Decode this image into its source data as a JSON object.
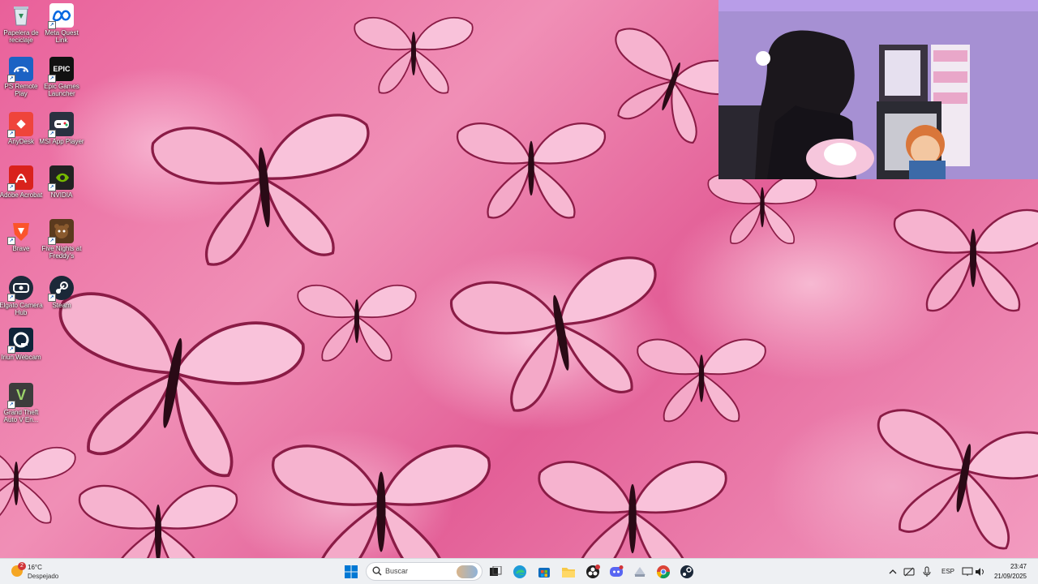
{
  "desktop": {
    "icons": [
      {
        "label": "Papelera de reciclaje",
        "icon": "recycle-bin-icon"
      },
      {
        "label": "Meta Quest Link",
        "icon": "meta-icon"
      },
      {
        "label": "PS Remote Play",
        "icon": "ps-remote-play-icon"
      },
      {
        "label": "Epic Games Launcher",
        "icon": "epic-games-icon",
        "glyph": "EPIC"
      },
      {
        "label": "AnyDesk",
        "icon": "anydesk-icon"
      },
      {
        "label": "MSI App Player",
        "icon": "msi-app-player-icon"
      },
      {
        "label": "Adobe Acrobat",
        "icon": "adobe-acrobat-icon"
      },
      {
        "label": "NVIDIA",
        "icon": "nvidia-icon"
      },
      {
        "label": "Brave",
        "icon": "brave-icon"
      },
      {
        "label": "Five Nights at Freddy's",
        "icon": "fnaf-icon"
      },
      {
        "label": "Elgato Camera Hub",
        "icon": "elgato-icon"
      },
      {
        "label": "Steam",
        "icon": "steam-icon"
      },
      {
        "label": "Iriun Webcam",
        "icon": "iriun-webcam-icon"
      },
      {
        "label": "Grand Theft Auto V En...",
        "icon": "gta-v-icon",
        "glyph": "V"
      }
    ]
  },
  "taskbar": {
    "weather": {
      "temperature": "16°C",
      "condition": "Despejado",
      "badge": "2"
    },
    "search_placeholder": "Buscar",
    "apps": [
      "windows-start-icon",
      "search-icon",
      "task-view-icon",
      "edge-icon",
      "microsoft-store-icon",
      "file-explorer-icon",
      "obs-icon",
      "discord-icon",
      "app-icon",
      "chrome-icon",
      "steam-icon"
    ],
    "tray": {
      "language": "ESP"
    },
    "clock": {
      "time": "23:47",
      "date": "21/09/2025"
    }
  },
  "colors": {
    "wallpaper_pink": "#e9609a",
    "taskbar_bg": "#eef0f3",
    "webcam_bg": "#a88fd4"
  }
}
